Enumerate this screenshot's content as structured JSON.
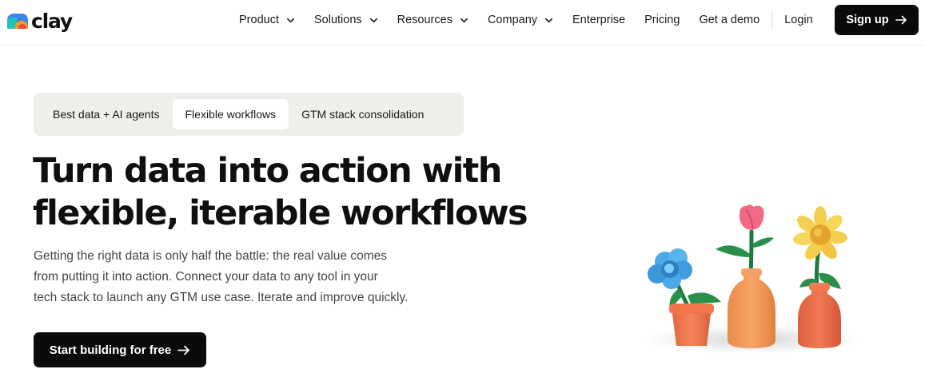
{
  "brand": {
    "name": "clay"
  },
  "nav": {
    "items": [
      {
        "label": "Product",
        "dropdown": true
      },
      {
        "label": "Solutions",
        "dropdown": true
      },
      {
        "label": "Resources",
        "dropdown": true
      },
      {
        "label": "Company",
        "dropdown": true
      },
      {
        "label": "Enterprise",
        "dropdown": false
      },
      {
        "label": "Pricing",
        "dropdown": false
      },
      {
        "label": "Get a demo",
        "dropdown": false
      }
    ],
    "login": "Login",
    "signup": "Sign up"
  },
  "tabs": [
    {
      "label": "Best data + AI agents",
      "active": false
    },
    {
      "label": "Flexible workflows",
      "active": true
    },
    {
      "label": "GTM stack consolidation",
      "active": false
    }
  ],
  "hero": {
    "title_line1": "Turn data into action with",
    "title_line2": "flexible, iterable workflows",
    "body_line1": "Getting the right data is only half the battle: the real value comes",
    "body_line2": "from putting it into action. Connect your data to any tool in your",
    "body_line3": "tech stack to launch any GTM use case. Iterate and improve quickly.",
    "cta": "Start building for free"
  },
  "icons": {
    "chevron": "chevron-down-icon",
    "arrow": "arrow-right-icon",
    "illustration": "clay-flowers-illustration"
  },
  "colors": {
    "primary_button": "#0b0b0b",
    "tab_bar": "#efeeea",
    "body_text": "#444444"
  }
}
